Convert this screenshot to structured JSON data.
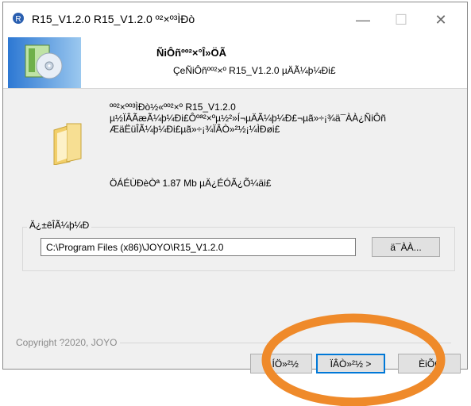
{
  "window": {
    "title": "R15_V1.2.0 R15_V1.2.0 º²×º³ÌÐò",
    "minimize_glyph": "—",
    "maximize_glyph": "☐",
    "close_glyph": "✕"
  },
  "header": {
    "title": "ÑiÔñºº²×°Î»ÖÃ",
    "subtitle": "ÇeÑiÔñºº²×º R15_V1.2.0 µÄÃ¼þ¼Ði£"
  },
  "info": {
    "lines": [
      "ºº²×ºº³ÌÐò½«ºº²×º R15_V1.2.0",
      "µ½ÏÂÃæÃ¼þ¼Ði£Ôºª²×ºµ½²»Í¬µÄÃ¼þ¼Ð£¬µã»÷¡¾ä¯ÀÀ¿ÑiÔñ",
      "ÆäËüÎÃ¼þ¼Ði£µã»÷¡¾ÏÂÒ»²½¡¼ÌÐøi£"
    ],
    "space": "ÖÁÉÙÐèÒª 1.87 Mb µÄ¿ÉÓÃ¿Õ¼äi£"
  },
  "destination": {
    "label": "Ä¿±êÎÃ¼þ¼Ð",
    "path": "C:\\Program Files (x86)\\JOYO\\R15_V1.2.0",
    "browse_label": "ä¯ÀÀ..."
  },
  "footer": {
    "copyright": "Copyright ?2020, JOYO",
    "back_label": "< ÍÖ»²½",
    "next_label": "ÏÂÒ»²½ >",
    "cancel_label": "ÈiÕû"
  },
  "annotation": {
    "ellipse_color": "#ef8a2a"
  }
}
